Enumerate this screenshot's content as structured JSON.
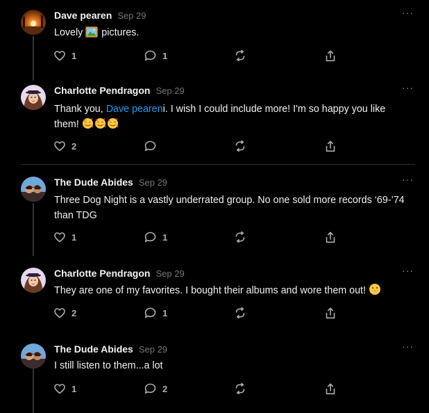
{
  "comments": [
    {
      "author": "Dave pearen",
      "date": "Sep 29",
      "text_before": "Lovely",
      "text_after": "pictures.",
      "likes": "1",
      "replies": "1"
    },
    {
      "author": "Charlotte Pendragon",
      "date": "Sep 29",
      "text_before": "Thank you,",
      "mention": "Dave pearen",
      "text_after": "i. I wish I could include more! I'm so happy you like them!",
      "likes": "2",
      "replies": ""
    },
    {
      "author": "The Dude Abides",
      "date": "Sep 29",
      "text": "Three Dog Night is a vastly underrated group. No one sold more records ‘69-’74 than TDG",
      "likes": "1",
      "replies": "1"
    },
    {
      "author": "Charlotte Pendragon",
      "date": "Sep 29",
      "text": "They are one of my favorites. I bought their albums and wore them out!",
      "likes": "2",
      "replies": "1"
    },
    {
      "author": "The Dude Abides",
      "date": "Sep 29",
      "text": "I still listen to them...a lot",
      "likes": "1",
      "replies": "2"
    }
  ],
  "more_label": "···",
  "icons": {
    "like": "heart-icon",
    "reply": "comment-bubble-icon",
    "restack": "restack-icon",
    "share": "share-icon",
    "more": "ellipsis-icon",
    "picture_emoji": "framed-picture-emoji",
    "hearts_emoji": "smiling-face-with-hearts-emoji",
    "smile_emoji": "grinning-face-emoji"
  },
  "colors": {
    "background": "#000000",
    "text": "#e7e9ea",
    "muted": "#71767b",
    "mention": "#1d9bf0",
    "thread_line": "#333639"
  }
}
